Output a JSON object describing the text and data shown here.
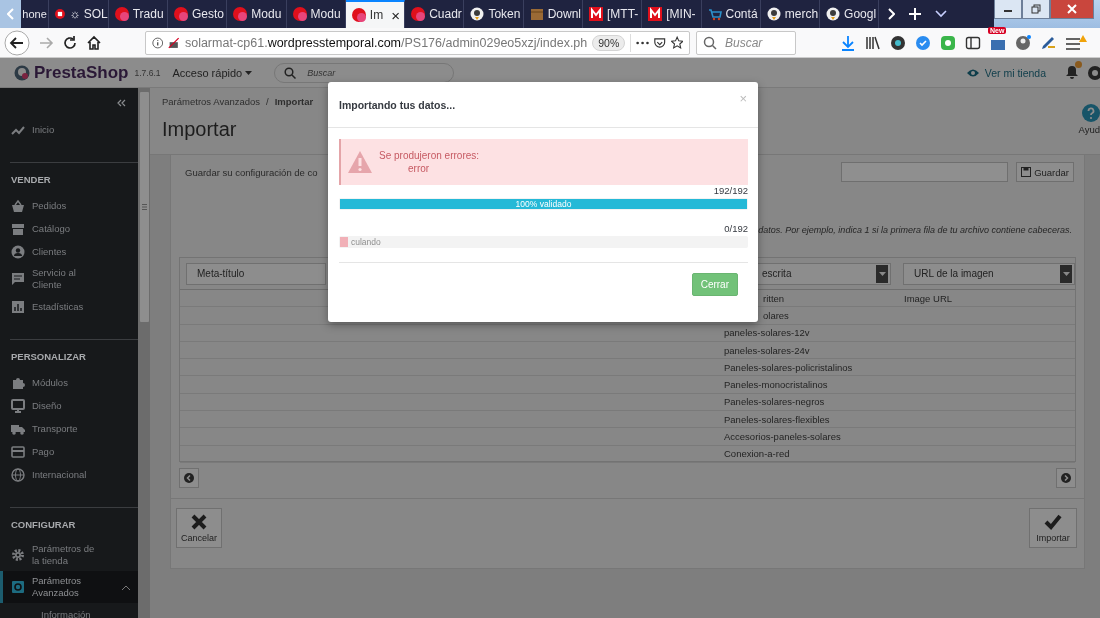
{
  "browser": {
    "tabs": [
      {
        "label": "hone",
        "kind": "none",
        "selected": false
      },
      {
        "label": "☼ SOL",
        "kind": "red-stop",
        "selected": false
      },
      {
        "label": "Tradu",
        "kind": "ps",
        "selected": false
      },
      {
        "label": "Gesto",
        "kind": "ps",
        "selected": false
      },
      {
        "label": "Modu",
        "kind": "ps",
        "selected": false
      },
      {
        "label": "Modu",
        "kind": "ps",
        "selected": false
      },
      {
        "label": "Im",
        "kind": "ps",
        "selected": true,
        "close": "×"
      },
      {
        "label": "Cuadr",
        "kind": "ps",
        "selected": false
      },
      {
        "label": "Token",
        "kind": "bird",
        "selected": false
      },
      {
        "label": "Downl",
        "kind": "box",
        "selected": false
      },
      {
        "label": "[MTT-",
        "kind": "m-logo",
        "selected": false
      },
      {
        "label": "[MIN-",
        "kind": "m-logo",
        "selected": false
      },
      {
        "label": "Contá",
        "kind": "cart",
        "selected": false
      },
      {
        "label": "merch",
        "kind": "bird",
        "selected": false
      },
      {
        "label": "Googl",
        "kind": "bird",
        "selected": false
      }
    ],
    "url": "solarmat-cp61.**wordpresstemporal.com**/PS176/admin029eo5xzj/index.ph",
    "zoom": "90%",
    "search_placeholder": "Buscar",
    "new_badge": "New"
  },
  "header": {
    "logo": "PrestaShop",
    "version": "1.7.6.1",
    "quick_access": "Acceso rápido",
    "search_placeholder": "Buscar",
    "store_link": "Ver mi tienda"
  },
  "sidebar": {
    "sections": [
      {
        "items": [
          {
            "label": "Inicio",
            "kind": "trend-line",
            "selected": false
          }
        ]
      },
      {
        "title": "VENDER",
        "items": [
          {
            "label": "Pedidos",
            "kind": "basket",
            "selected": false
          },
          {
            "label": "Catálogo",
            "kind": "storefront",
            "selected": false
          },
          {
            "label": "Clientes",
            "kind": "person",
            "selected": false
          },
          {
            "label": "Servicio al Cliente",
            "kind": "speech-bubble",
            "selected": false
          },
          {
            "label": "Estadísticas",
            "kind": "bar-chart",
            "selected": false
          }
        ]
      },
      {
        "title": "PERSONALIZAR",
        "items": [
          {
            "label": "Módulos",
            "kind": "puzzle",
            "selected": false
          },
          {
            "label": "Diseño",
            "kind": "monitor",
            "selected": false
          },
          {
            "label": "Transporte",
            "kind": "truck",
            "selected": false
          },
          {
            "label": "Pago",
            "kind": "credit-card",
            "selected": false
          },
          {
            "label": "Internacional",
            "kind": "globe",
            "selected": false
          }
        ]
      },
      {
        "title": "CONFIGURAR",
        "items": [
          {
            "label": "Parámetros de la tienda",
            "kind": "gear",
            "selected": false
          },
          {
            "label": "Parámetros Avanzados",
            "kind": "gear-square",
            "selected": true,
            "expanded": true,
            "children": [
              {
                "label": "Información",
                "selected": false
              }
            ]
          }
        ]
      }
    ]
  },
  "page": {
    "breadcrumb": [
      "Parámetros Avanzados",
      "Importar"
    ],
    "breadcrumb_separator": "/",
    "title": "Importar",
    "help": "Ayud"
  },
  "import_form": {
    "save_config_label": "Guardar su configuración de co",
    "save_button": "Guardar",
    "hint": "datos. Por ejemplo, indica 1 si la primera fila de tu archivo contiene cabeceras.",
    "column_selects": [
      {
        "label": "Meta-título",
        "arrow": false
      },
      {
        "label": "escrita",
        "arrow": true
      },
      {
        "label": "URL de la imagen",
        "arrow": true
      }
    ],
    "rows": [
      {
        "column_2": "ritten",
        "column_3": "Image URL",
        "covered": true
      },
      {
        "column_2": "olares",
        "covered": true
      },
      {
        "column_2": "paneles-solares-12v",
        "covered": false
      },
      {
        "column_2": "paneles-solares-24v",
        "covered": false
      },
      {
        "column_2": "Paneles-solares-policristalinos",
        "covered": false
      },
      {
        "column_2": "Paneles-monocristalinos",
        "covered": false
      },
      {
        "column_2": "Paneles-solares-negros",
        "covered": false
      },
      {
        "column_2": "Paneles-solares-flexibles",
        "covered": false
      },
      {
        "column_2": "Accesorios-paneles-solares",
        "covered": false
      },
      {
        "column_2": "Conexion-a-red",
        "covered": false
      }
    ],
    "cancel_button": "Cancelar",
    "import_button": "Importar"
  },
  "modal": {
    "title": "Importando tus datos...",
    "close": "×",
    "alert": {
      "title": "Se produjeron errores:",
      "message": "error"
    },
    "progress": [
      {
        "kind": "validate",
        "count": "192/192",
        "label": "100% validado",
        "level": 1
      },
      {
        "kind": "import",
        "count": "0/192",
        "label": "culando",
        "level": 0.02
      }
    ],
    "close_button": "Cerrar"
  }
}
